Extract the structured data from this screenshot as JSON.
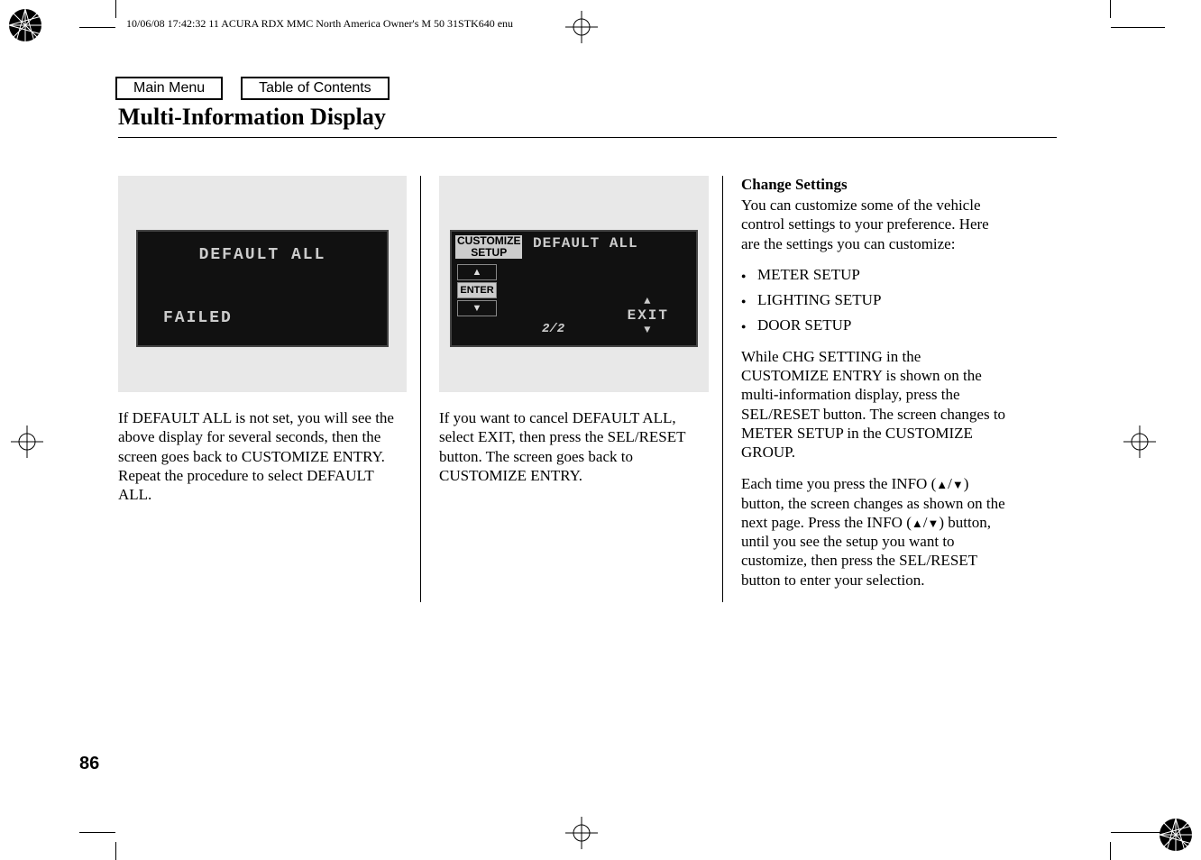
{
  "header": "10/06/08 17:42:32   11 ACURA RDX MMC North America Owner's M 50 31STK640 enu",
  "nav": {
    "main": "Main Menu",
    "toc": "Table of Contents"
  },
  "title": "Multi-Information Display",
  "col1": {
    "lcd_title": "DEFAULT ALL",
    "lcd_status": "FAILED",
    "text": "If DEFAULT ALL is not set, you will see the above display for several seconds, then the screen goes back to CUSTOMIZE ENTRY. Repeat the procedure to select DEFAULT ALL."
  },
  "col2": {
    "lcd_label1": "CUSTOMIZE",
    "lcd_label2": "SETUP",
    "lcd_default": "DEFAULT ALL",
    "lcd_enter": "ENTER",
    "lcd_exit": "EXIT",
    "lcd_page": "2/2",
    "text": "If you want to cancel DEFAULT ALL, select EXIT, then press the SEL/RESET button. The screen goes back to CUSTOMIZE ENTRY."
  },
  "col3": {
    "heading": "Change Settings",
    "intro": "You can customize some of the vehicle control settings to your preference. Here are the settings you can customize:",
    "bullets": [
      "METER SETUP",
      "LIGHTING SETUP",
      "DOOR SETUP"
    ],
    "p2": "While CHG SETTING in the CUSTOMIZE ENTRY is shown on the multi-information display, press the SEL/RESET button. The screen changes to METER SETUP in the CUSTOMIZE GROUP.",
    "p3a": "Each time you press the INFO (",
    "p3b": ") button, the screen changes as shown on the next page. Press the INFO (",
    "p3c": ") button, until you see the setup you want to customize, then press the SEL/RESET button to enter your selection."
  },
  "page_number": "86"
}
